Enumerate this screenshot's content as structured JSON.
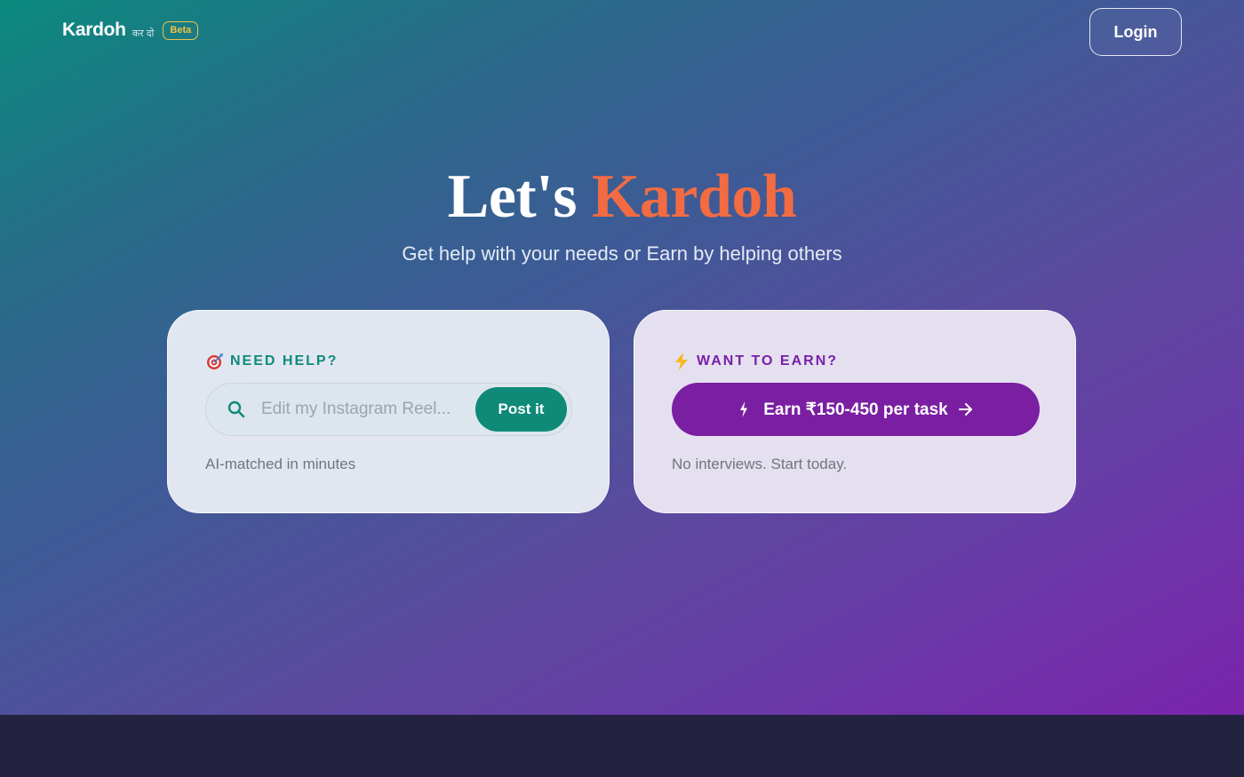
{
  "header": {
    "brand_name": "Kardoh",
    "brand_sub": "कर दो",
    "beta_badge": "Beta",
    "login_label": "Login"
  },
  "hero": {
    "title_main": "Let's",
    "title_accent": "Kardoh",
    "subtitle": "Get help with your needs or Earn by helping others"
  },
  "help_card": {
    "label": "NEED HELP?",
    "label_icon": "target-icon",
    "search_placeholder": "Edit my Instagram Reel...",
    "post_button": "Post it",
    "note": "AI-matched in minutes"
  },
  "earn_card": {
    "label": "WANT TO EARN?",
    "label_icon": "lightning-icon",
    "earn_button": "Earn ₹150-450 per task",
    "note": "No interviews. Start today."
  },
  "colors": {
    "accent_orange": "#f26b42",
    "teal": "#0f8a78",
    "purple": "#7a1fa2",
    "beta_yellow": "#f0c24a",
    "footer": "#232240"
  }
}
